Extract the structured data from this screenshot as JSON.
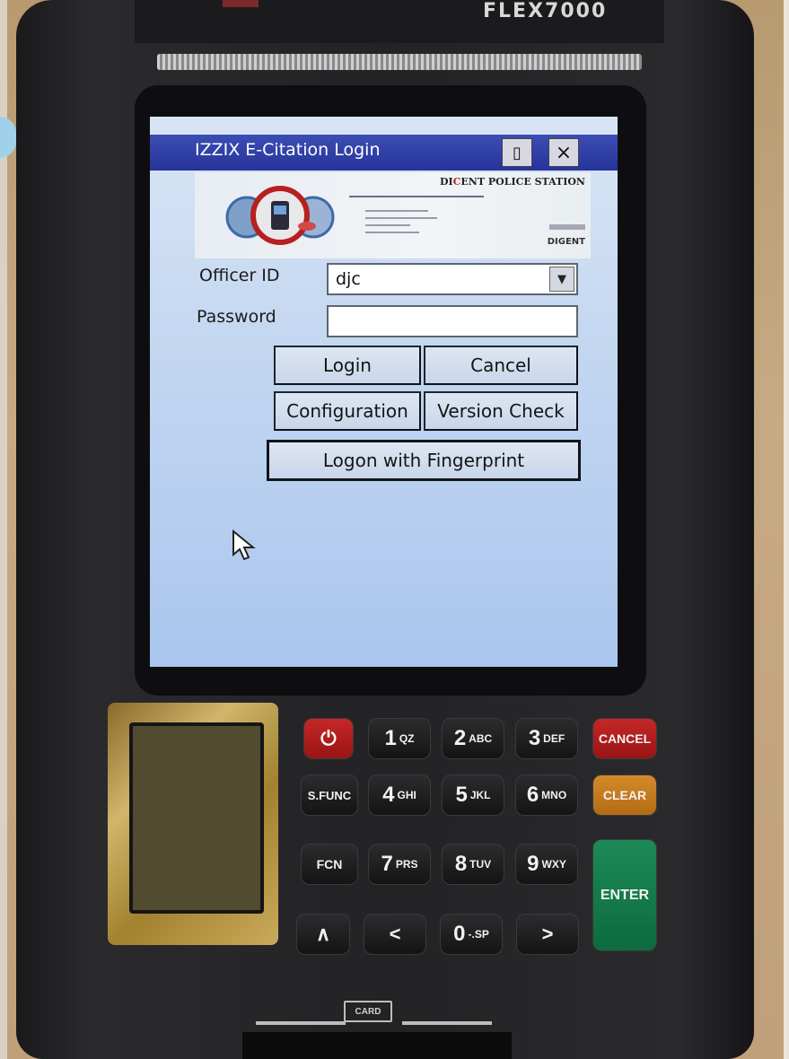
{
  "device": {
    "brand": "FLEX7000",
    "keypad": {
      "row1": [
        {
          "id": "power",
          "label": "⏻"
        },
        {
          "id": "1",
          "big": "1",
          "small": "QZ"
        },
        {
          "id": "2",
          "big": "2",
          "small": "ABC"
        },
        {
          "id": "3",
          "big": "3",
          "small": "DEF"
        },
        {
          "id": "cancel",
          "label": "CANCEL"
        }
      ],
      "row2": [
        {
          "id": "sfunc",
          "label": "S.FUNC"
        },
        {
          "id": "4",
          "big": "4",
          "small": "GHI"
        },
        {
          "id": "5",
          "big": "5",
          "small": "JKL"
        },
        {
          "id": "6",
          "big": "6",
          "small": "MNO"
        },
        {
          "id": "clear",
          "label": "CLEAR"
        }
      ],
      "row3": [
        {
          "id": "fcn",
          "label": "FCN"
        },
        {
          "id": "7",
          "big": "7",
          "small": "PRS"
        },
        {
          "id": "8",
          "big": "8",
          "small": "TUV"
        },
        {
          "id": "9",
          "big": "9",
          "small": "WXY"
        }
      ],
      "row4": [
        {
          "id": "up",
          "label": "∧"
        },
        {
          "id": "left",
          "label": "<"
        },
        {
          "id": "0",
          "big": "0",
          "small": "-.SP"
        },
        {
          "id": "right",
          "label": ">"
        }
      ],
      "enter": "ENTER"
    },
    "card_label": "CARD"
  },
  "window": {
    "title": "IZZIX E-Citation Login",
    "maximize_glyph": "▯",
    "close_glyph": "×"
  },
  "banner": {
    "station_prefix": "DI",
    "station_highlight": "C",
    "station_suffix": "ENT POLICE STATION",
    "brand": "DIGENT"
  },
  "form": {
    "officer_label": "Officer ID",
    "officer_value": "djc",
    "password_label": "Password",
    "password_value": ""
  },
  "buttons": {
    "login": "Login",
    "cancel": "Cancel",
    "configuration": "Configuration",
    "version_check": "Version Check",
    "fingerprint": "Logon with Fingerprint"
  },
  "colors": {
    "titlebar": "#26349a",
    "screen_bg": "#c2d6f0",
    "cancel_key": "#c62828",
    "clear_key": "#d48a2a",
    "enter_key": "#0d6b3f"
  }
}
